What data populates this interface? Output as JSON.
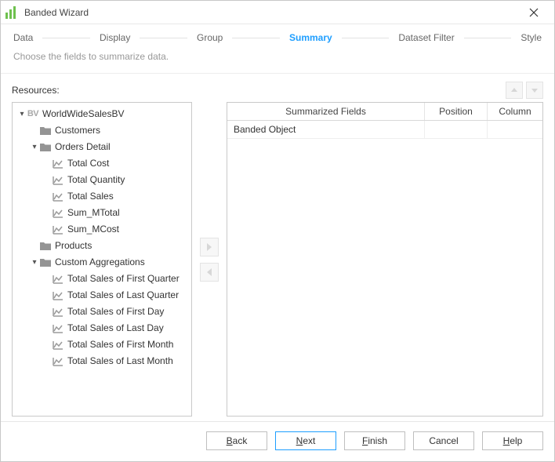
{
  "window": {
    "title": "Banded Wizard"
  },
  "steps": {
    "items": [
      {
        "label": "Data",
        "active": false
      },
      {
        "label": "Display",
        "active": false
      },
      {
        "label": "Group",
        "active": false
      },
      {
        "label": "Summary",
        "active": true
      },
      {
        "label": "Dataset Filter",
        "active": false
      },
      {
        "label": "Style",
        "active": false
      }
    ]
  },
  "description": "Choose the fields to summarize data.",
  "left": {
    "label": "Resources:"
  },
  "tree": [
    {
      "depth": 0,
      "caret": "open",
      "icon": "bv",
      "label": "WorldWideSalesBV"
    },
    {
      "depth": 1,
      "caret": "none",
      "icon": "folder",
      "label": "Customers"
    },
    {
      "depth": 1,
      "caret": "open",
      "icon": "folder",
      "label": "Orders Detail"
    },
    {
      "depth": 2,
      "caret": "none",
      "icon": "metric",
      "label": "Total Cost"
    },
    {
      "depth": 2,
      "caret": "none",
      "icon": "metric",
      "label": "Total Quantity"
    },
    {
      "depth": 2,
      "caret": "none",
      "icon": "metric",
      "label": "Total Sales"
    },
    {
      "depth": 2,
      "caret": "none",
      "icon": "metric",
      "label": "Sum_MTotal"
    },
    {
      "depth": 2,
      "caret": "none",
      "icon": "metric",
      "label": "Sum_MCost"
    },
    {
      "depth": 1,
      "caret": "none",
      "icon": "folder",
      "label": "Products"
    },
    {
      "depth": 1,
      "caret": "open",
      "icon": "folder",
      "label": "Custom Aggregations"
    },
    {
      "depth": 2,
      "caret": "none",
      "icon": "metric",
      "label": "Total Sales of First Quarter"
    },
    {
      "depth": 2,
      "caret": "none",
      "icon": "metric",
      "label": "Total Sales of Last Quarter"
    },
    {
      "depth": 2,
      "caret": "none",
      "icon": "metric",
      "label": "Total Sales of First Day"
    },
    {
      "depth": 2,
      "caret": "none",
      "icon": "metric",
      "label": "Total Sales of Last Day"
    },
    {
      "depth": 2,
      "caret": "none",
      "icon": "metric",
      "label": "Total Sales of First Month"
    },
    {
      "depth": 2,
      "caret": "none",
      "icon": "metric",
      "label": "Total Sales of Last Month"
    }
  ],
  "table": {
    "headers": {
      "c1": "Summarized Fields",
      "c2": "Position",
      "c3": "Column"
    },
    "rows": [
      {
        "c1": "Banded Object",
        "c2": "",
        "c3": ""
      }
    ]
  },
  "buttons": {
    "back": "Back",
    "next": "Next",
    "finish": "Finish",
    "cancel": "Cancel",
    "help": "Help"
  }
}
